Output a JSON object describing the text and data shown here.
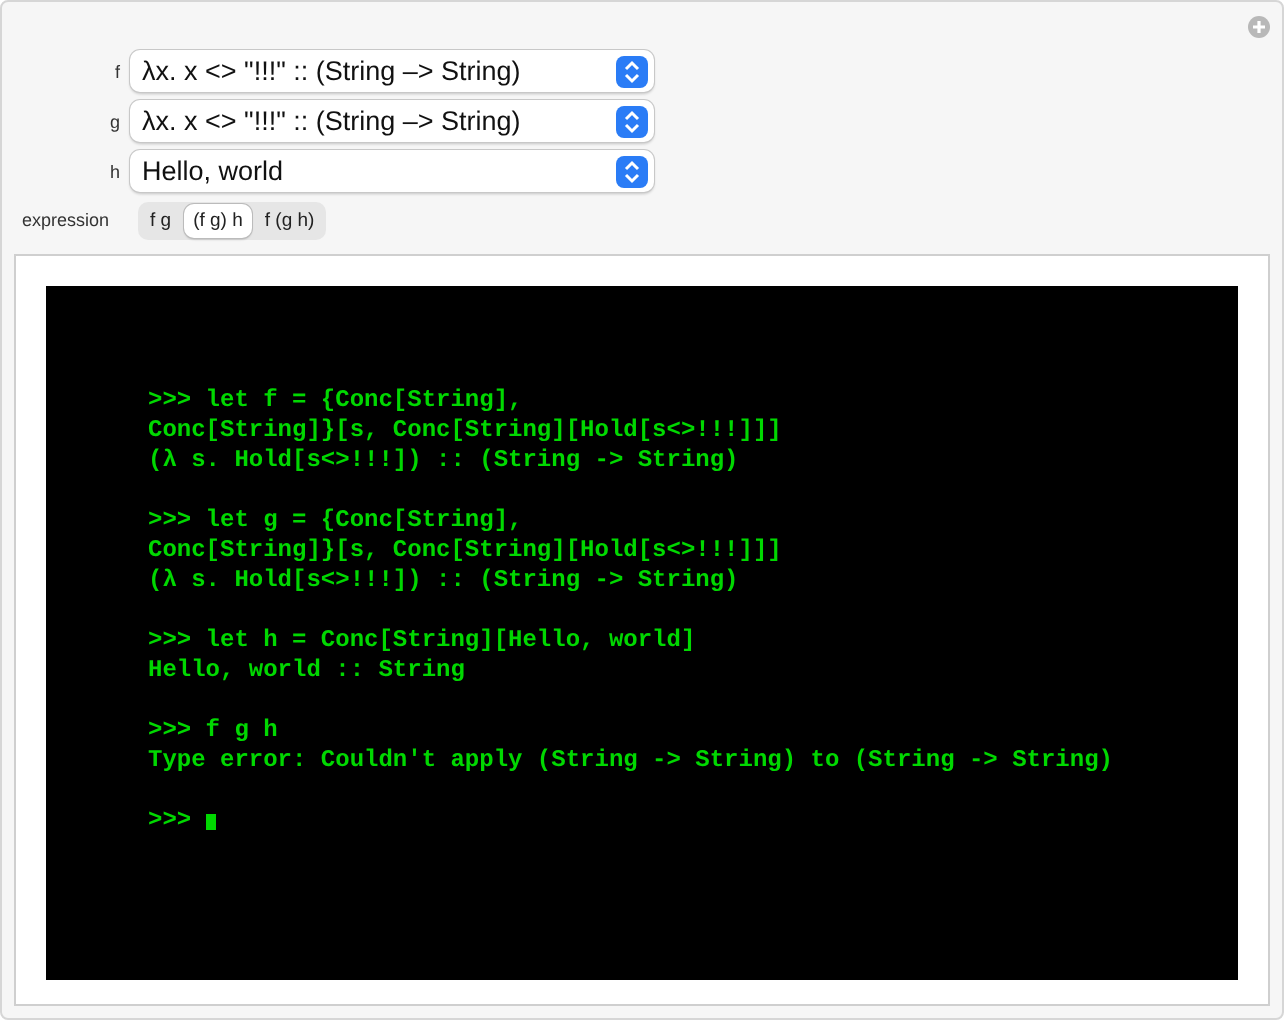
{
  "controls": [
    {
      "label": "f",
      "value": "λx. x <> \"!!!\" :: (String –> String)"
    },
    {
      "label": "g",
      "value": "λx. x <> \"!!!\" :: (String –> String)"
    },
    {
      "label": "h",
      "value": "Hello, world"
    }
  ],
  "expression": {
    "label": "expression",
    "options": [
      {
        "label": "f g",
        "selected": false
      },
      {
        "label": "(f g) h",
        "selected": true
      },
      {
        "label": "f (g h)",
        "selected": false
      }
    ]
  },
  "terminal": {
    "blocks": [
      {
        "lines": [
          ">>> let f = {Conc[String],",
          "Conc[String]}[s, Conc[String][Hold[s<>!!!]]]",
          "(λ s. Hold[s<>!!!]) :: (String -> String)"
        ]
      },
      {
        "lines": [
          ">>> let g = {Conc[String],",
          "Conc[String]}[s, Conc[String][Hold[s<>!!!]]]",
          "(λ s. Hold[s<>!!!]) :: (String -> String)"
        ]
      },
      {
        "lines": [
          ">>> let h = Conc[String][Hello, world]",
          "Hello, world :: String"
        ]
      },
      {
        "lines": [
          ">>> f g h",
          "Type error: Couldn't apply (String -> String) to (String -> String)"
        ]
      }
    ],
    "prompt": ">>>"
  }
}
